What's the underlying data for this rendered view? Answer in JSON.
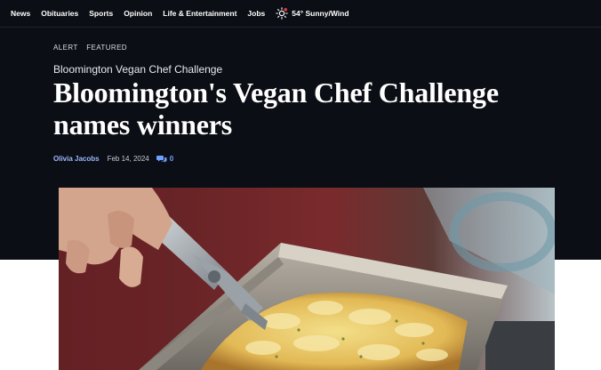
{
  "nav": {
    "items": [
      "News",
      "Obituaries",
      "Sports",
      "Opinion",
      "Life & Entertainment",
      "Jobs"
    ],
    "weather": {
      "text": "54° Sunny/Wind",
      "icon": "sun-icon"
    }
  },
  "article": {
    "tags": [
      "ALERT",
      "FEATURED"
    ],
    "category": "Bloomington Vegan Chef Challenge",
    "headline": "Bloomington's Vegan Chef Challenge names winners",
    "author": "Olivia Jacobs",
    "date": "Feb 14, 2024",
    "comment_count": "0",
    "comment_icon": "comment-bubble-icon"
  },
  "hero_image": {
    "depicts": "hand-with-tongs-holding-pan-of-potato-gratin"
  },
  "colors": {
    "header_bg": "#0b0e14",
    "author_link": "#9db8ff",
    "comment_link": "#6fa0ff"
  }
}
